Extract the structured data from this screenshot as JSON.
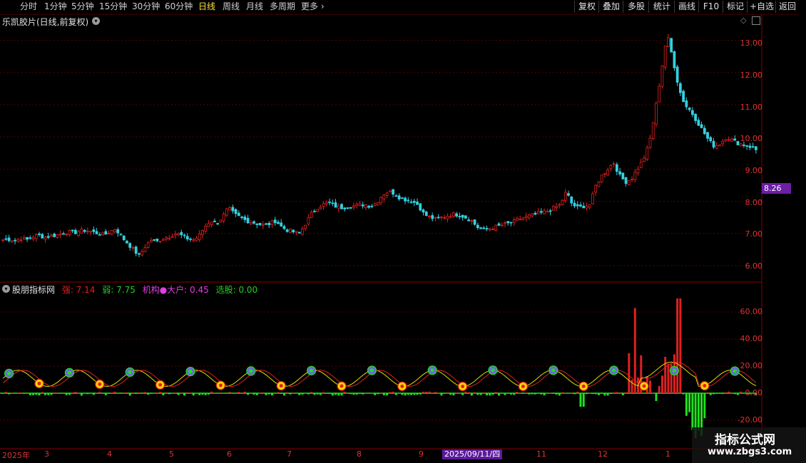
{
  "toolbar": {
    "tabs": [
      "分时",
      "1分钟",
      "5分钟",
      "15分钟",
      "30分钟",
      "60分钟",
      "日线",
      "周线",
      "月线",
      "多周期",
      "更多"
    ],
    "active_tab": "日线",
    "more_arrow": "›",
    "right_buttons": [
      "复权",
      "叠加",
      "多股",
      "统计",
      "画线",
      "F10",
      "标记",
      "+自选",
      "返回"
    ]
  },
  "main_chart": {
    "title": "乐凯胶片(日线,前复权)",
    "dropdown_icon": "chevron-down-icon",
    "current_price_tag": "8.26",
    "y_ticks": [
      "13.00",
      "12.00",
      "11.00",
      "10.00",
      "9.00",
      "8.00",
      "7.00",
      "6.00"
    ]
  },
  "indicator": {
    "name": "股朋指标网",
    "strong_label": "强:",
    "strong_value": "7.14",
    "weak_label": "弱:",
    "weak_value": "7.75",
    "inst_label": "机构●大户:",
    "inst_value": "0.45",
    "pick_label": "选股:",
    "pick_value": "0.00",
    "y_ticks": [
      "60.00",
      "40.00",
      "20.00",
      "0.00",
      "-20.00"
    ]
  },
  "x_axis": {
    "labels": [
      "2025年",
      "3",
      "4",
      "5",
      "6",
      "7",
      "8",
      "9",
      "11",
      "12",
      "1"
    ],
    "highlight_date": "2025/09/11/四"
  },
  "watermark": {
    "line1": "指标公式网",
    "line2": "www.zbgs3.com"
  },
  "colors": {
    "up": "#e02020",
    "down": "#35d0e0",
    "grid": "#5a0000",
    "accent": "#ffe23a",
    "indicator_pos": "#e02020",
    "indicator_neg": "#20e020"
  },
  "chart_data": {
    "type": "candlestick",
    "ylim": [
      5.6,
      13.7
    ],
    "closes": [
      6.8,
      6.82,
      6.78,
      6.85,
      6.8,
      6.9,
      6.95,
      6.88,
      6.92,
      6.95,
      7.0,
      7.05,
      7.02,
      7.08,
      7.1,
      7.05,
      7.0,
      6.95,
      7.05,
      7.15,
      6.9,
      6.7,
      6.5,
      6.3,
      6.6,
      6.8,
      6.75,
      6.85,
      6.9,
      7.0,
      6.95,
      6.85,
      6.8,
      6.9,
      7.2,
      7.4,
      7.3,
      7.5,
      7.8,
      7.6,
      7.5,
      7.4,
      7.35,
      7.3,
      7.25,
      7.3,
      7.4,
      7.2,
      7.1,
      7.05,
      7.0,
      7.3,
      7.6,
      7.8,
      7.9,
      7.95,
      7.85,
      7.8,
      7.82,
      7.85,
      7.88,
      7.9,
      7.85,
      7.95,
      8.2,
      8.3,
      8.25,
      8.1,
      8.05,
      8.0,
      7.9,
      7.6,
      7.5,
      7.45,
      7.5,
      7.55,
      7.6,
      7.58,
      7.5,
      7.4,
      7.2,
      7.1,
      7.15,
      7.2,
      7.25,
      7.3,
      7.35,
      7.45,
      7.5,
      7.55,
      7.6,
      7.65,
      7.7,
      7.8,
      7.9,
      8.3,
      7.9,
      7.8,
      7.85,
      7.9,
      8.5,
      8.8,
      9.0,
      9.2,
      8.8,
      8.6,
      8.7,
      9.0,
      9.3,
      9.8,
      10.8,
      12.0,
      13.2,
      12.4,
      11.5,
      11.0,
      10.8,
      10.5,
      10.2,
      9.9,
      9.7,
      9.8,
      10.0,
      9.9,
      9.8,
      9.75,
      9.7,
      9.6
    ]
  }
}
